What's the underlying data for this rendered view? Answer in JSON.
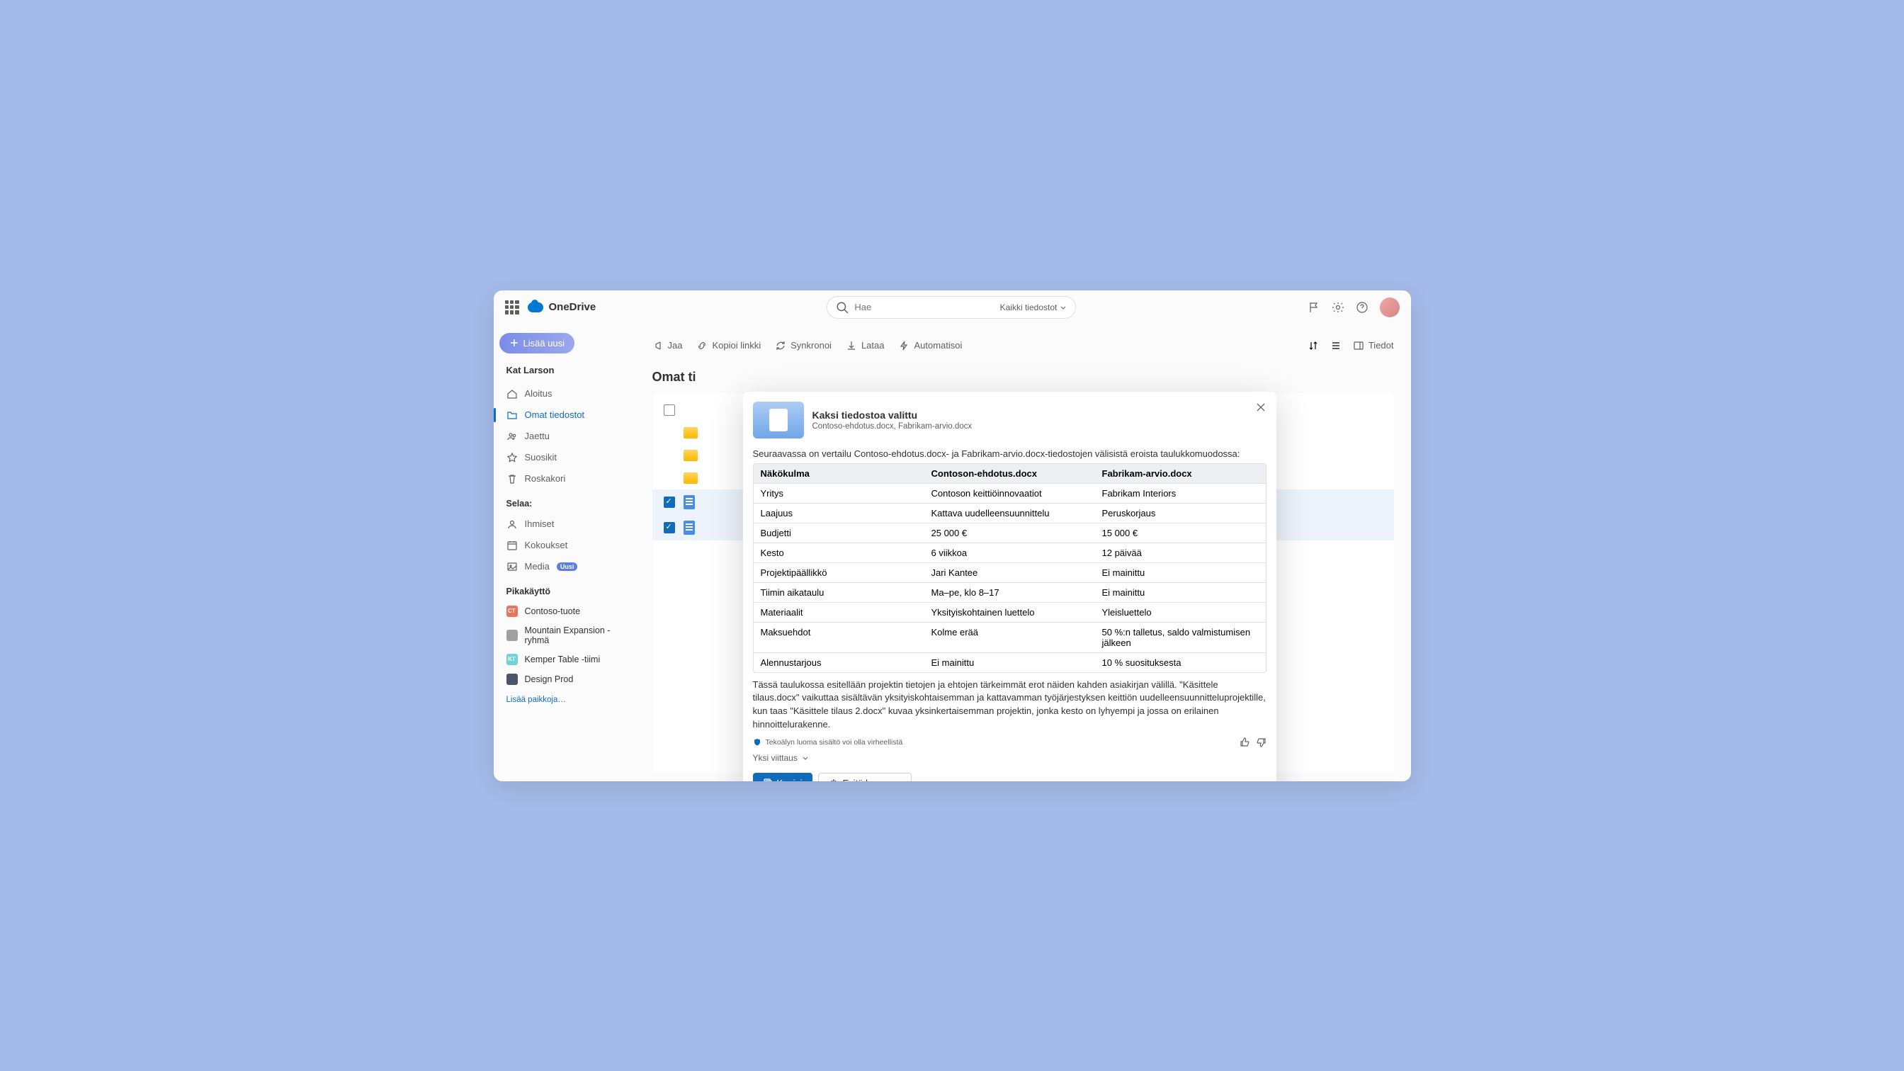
{
  "brand_name": "OneDrive",
  "search": {
    "placeholder": "Hae",
    "scope": "Kaikki tiedostot"
  },
  "new_button": "Lisää uusi",
  "user_name": "Kat Larson",
  "nav": {
    "home": "Aloitus",
    "my_files": "Omat tiedostot",
    "shared": "Jaettu",
    "favorites": "Suosikit",
    "recycle": "Roskakori"
  },
  "browse": {
    "heading": "Selaa:",
    "people": "Ihmiset",
    "meetings": "Kokoukset",
    "media": "Media",
    "media_badge": "Uusi"
  },
  "quick_access": {
    "heading": "Pikakäyttö",
    "items": [
      {
        "label": "Contoso-tuote",
        "abbr": "CT"
      },
      {
        "label": "Mountain Expansion -ryhmä",
        "abbr": ""
      },
      {
        "label": "Kemper Table -tiimi",
        "abbr": "KT"
      },
      {
        "label": "Design Prod",
        "abbr": ""
      }
    ],
    "more": "Lisää paikkoja…"
  },
  "toolbar": {
    "share": "Jaa",
    "copy_link": "Kopioi linkki",
    "sync": "Synkronoi",
    "download": "Lataa",
    "automate": "Automatisoi",
    "details": "Tiedot"
  },
  "page_title": "Omat ti",
  "modal": {
    "title": "Kaksi tiedostoa valittu",
    "subtitle": "Contoso-ehdotus.docx, Fabrikam-arvio.docx",
    "intro": "Seuraavassa on vertailu Contoso-ehdotus.docx- ja Fabrikam-arvio.docx-tiedostojen välisistä eroista taulukkomuodossa:",
    "headers": [
      "Näkökulma",
      "Contoson-ehdotus.docx",
      "Fabrikam-arvio.docx"
    ],
    "rows": [
      [
        "Yritys",
        "Contoson keittiöinnovaatiot",
        "Fabrikam Interiors"
      ],
      [
        "Laajuus",
        "Kattava uudelleensuunnittelu",
        "Peruskorjaus"
      ],
      [
        "Budjetti",
        "25 000 €",
        "15 000 €"
      ],
      [
        "Kesto",
        "6 viikkoa",
        "12 päivää"
      ],
      [
        "Projektipäällikkö",
        "Jari Kantee",
        "Ei mainittu"
      ],
      [
        "Tiimin aikataulu",
        "Ma–pe, klo 8–17",
        "Ei mainittu"
      ],
      [
        "Materiaalit",
        "Yksityiskohtainen luettelo",
        "Yleisluettelo"
      ],
      [
        "Maksuehdot",
        "Kolme erää",
        "50 %:n talletus, saldo valmistumisen jälkeen"
      ],
      [
        "Alennustarjous",
        "Ei mainittu",
        "10 % suosituksesta"
      ]
    ],
    "outro": "Tässä taulukossa esitellään projektin tietojen ja ehtojen tärkeimmät erot näiden kahden asiakirjan välillä. \"Käsittele tilaus.docx\" vaikuttaa sisältävän yksityiskohtaisemman ja kattavamman työjärjestyksen keittiön uudelleensuunnitteluprojektille, kun taas \"Käsittele tilaus 2.docx\" kuvaa yksinkertaisemman projektin, jonka kesto on lyhyempi ja jossa on erilainen hinnoittelurakenne.",
    "ai_note": "Tekoälyn luoma sisältö voi olla virheellistä",
    "reference": "Yksi viittaus",
    "copy_btn": "Kopioi",
    "ask_btn": "Esitä kysymys"
  }
}
